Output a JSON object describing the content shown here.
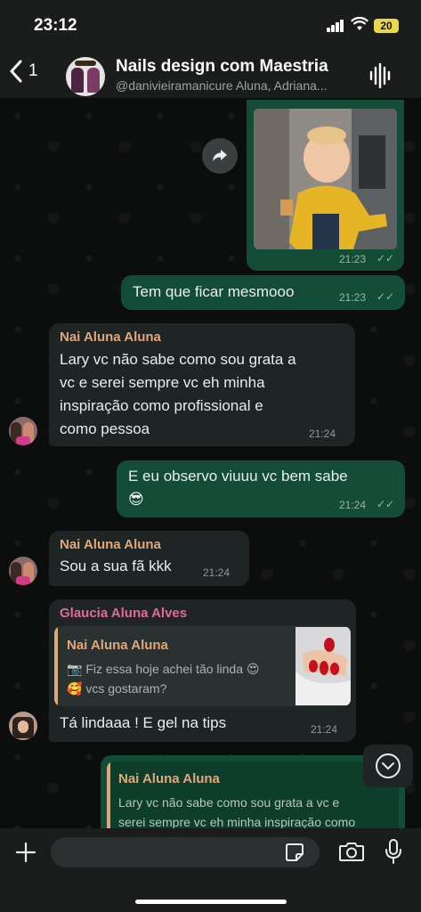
{
  "status": {
    "time": "23:12",
    "battery": "20"
  },
  "header": {
    "back_count": "1",
    "title": "Nails design com Maestria",
    "subtitle": "@danivieiramanicure Aluna, Adriana..."
  },
  "messages": [
    {
      "type": "outgoing-image",
      "time": "21:23"
    },
    {
      "type": "outgoing",
      "text": "Tem que ficar mesmooo",
      "time": "21:23"
    },
    {
      "type": "incoming",
      "sender": "Nai Aluna Aluna",
      "lines": [
        "Lary vc não sabe como sou grata a",
        "vc e serei sempre vc eh minha",
        "inspiração como profissional e",
        "como pessoa"
      ],
      "time": "21:24"
    },
    {
      "type": "outgoing",
      "lines": [
        "E eu observo viuuu vc bem sabe",
        "😎"
      ],
      "time": "21:24"
    },
    {
      "type": "incoming",
      "sender": "Nai Aluna Aluna",
      "text": "Sou a sua fã kkk",
      "time": "21:24"
    },
    {
      "type": "incoming-reply",
      "sender": "Glaucia Aluna Alves",
      "quote_sender": "Nai Aluna Aluna",
      "quote_lines": [
        "📷 Fiz essa hoje achei tão linda 😍",
        "🥰 vcs gostaram?"
      ],
      "text": "Tá lindaaa ! E gel na tips",
      "time": "21:24"
    },
    {
      "type": "outgoing-reply",
      "quote_sender": "Nai Aluna Aluna",
      "quote_lines": [
        "Lary vc não sabe como sou grata a vc e",
        "serei sempre vc eh minha inspiração como"
      ]
    }
  ],
  "colors": {
    "outgoing": "#144d37",
    "incoming": "#1f2424",
    "sender_name": "#e0a77b",
    "sender_name_alt": "#e06b9a"
  },
  "icons": [
    "chevron-left-icon",
    "voice-wave-icon",
    "forward-icon",
    "scroll-down-icon",
    "plus-icon",
    "sticker-icon",
    "camera-icon",
    "microphone-icon"
  ]
}
